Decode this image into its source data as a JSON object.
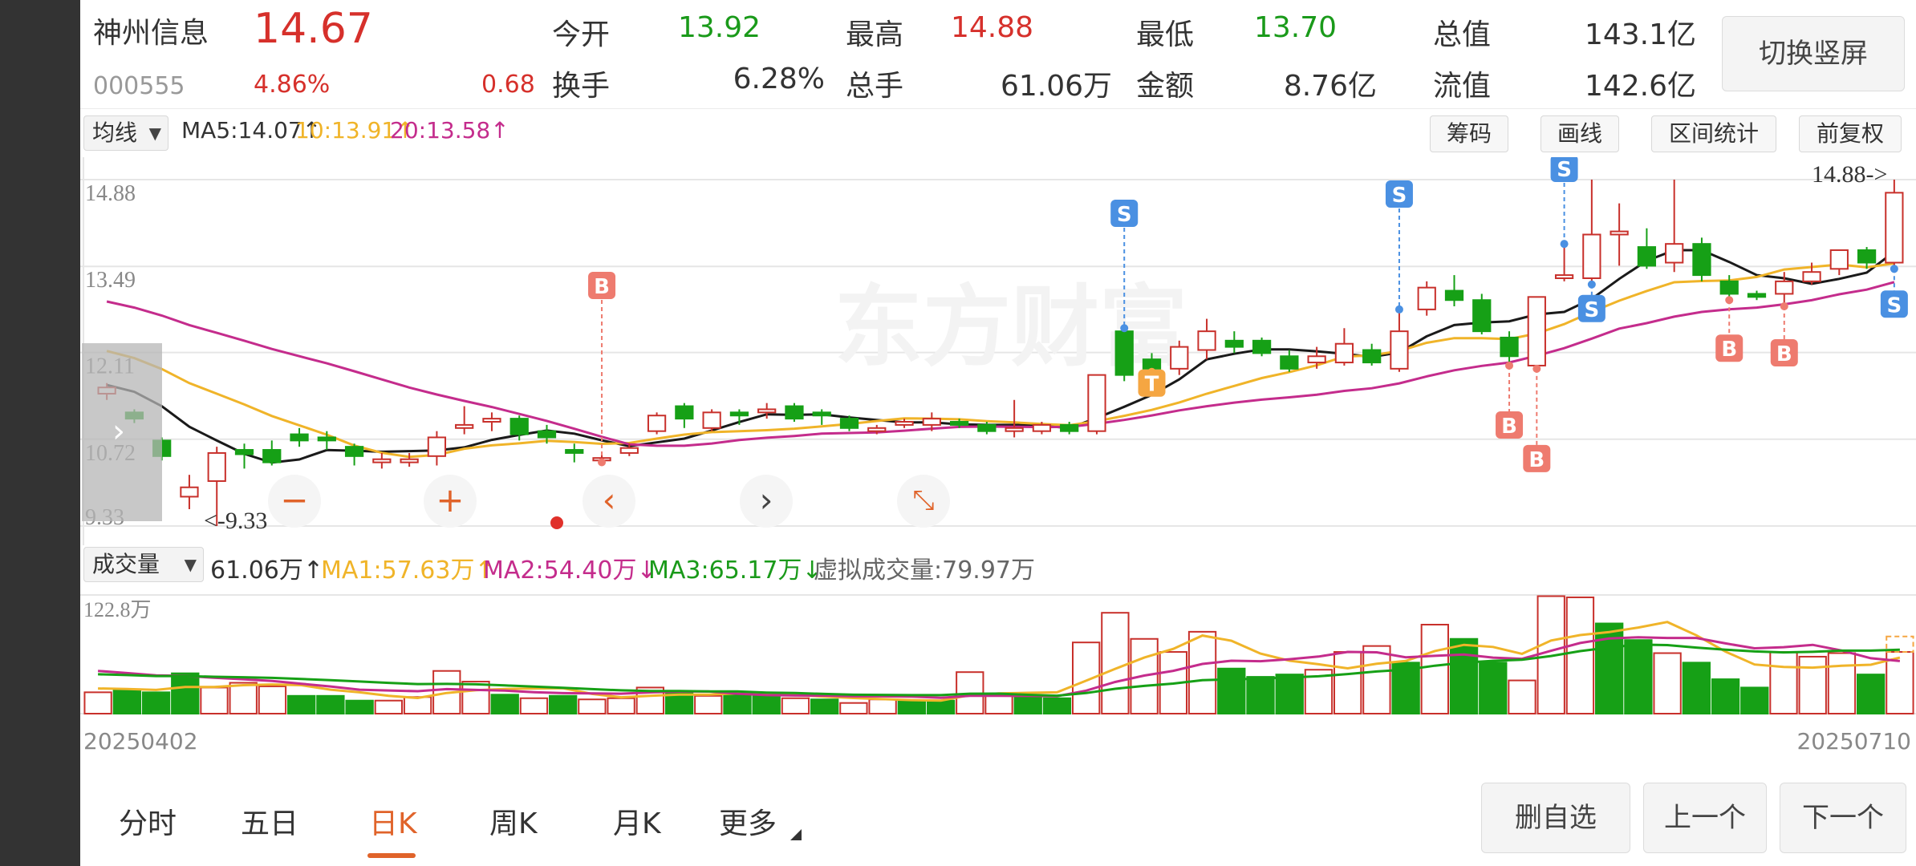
{
  "quote": {
    "name": "神州信息",
    "price": "14.67",
    "code": "000555",
    "change_pct": "4.86%",
    "change_amt": "0.68",
    "open_label": "今开",
    "open": "13.92",
    "high_label": "最高",
    "high": "14.88",
    "low_label": "最低",
    "low": "13.70",
    "mcap_label": "总值",
    "mcap": "143.1亿",
    "turnover_label": "换手",
    "turnover": "6.28%",
    "volume_label": "总手",
    "volume": "61.06万",
    "amount_label": "金额",
    "amount": "8.76亿",
    "float_label": "流值",
    "float_mcap": "142.6亿",
    "switch_button": "切换竖屏"
  },
  "toolbar": {
    "indicator": "均线",
    "ma5": "MA5:14.07↑",
    "ma10": "10:13.91↑",
    "ma20": "20:13.58↑",
    "chips": "筹码",
    "draw": "画线",
    "range_stats": "区间统计",
    "adjust": "前复权"
  },
  "price_axis": {
    "labels": [
      "14.88",
      "13.49",
      "12.11",
      "10.72",
      "9.33"
    ],
    "high_marker": "14.88->",
    "low_marker": "<-9.33"
  },
  "signals": {
    "s": "S",
    "b": "B",
    "t": "T"
  },
  "watermark": "东方财富",
  "volume": {
    "indicator": "成交量",
    "current": "61.06万↑",
    "ma1": "MA1:57.63万↑",
    "ma2": "MA2:54.40万↓",
    "ma3": "MA3:65.17万↓",
    "virtual": "虚拟成交量:79.97万",
    "max_label": "122.8万"
  },
  "dates": {
    "start": "20250402",
    "end": "20250710"
  },
  "tabs": [
    {
      "label": "分时"
    },
    {
      "label": "五日"
    },
    {
      "label": "日K"
    },
    {
      "label": "周K"
    },
    {
      "label": "月K"
    },
    {
      "label": "更多"
    }
  ],
  "bottom_buttons": {
    "remove": "删自选",
    "prev": "上一个",
    "next": "下一个"
  },
  "colors": {
    "up": "#c8302b",
    "down": "#16a016",
    "ma5": "#1a1a1a",
    "ma10": "#f0b429",
    "ma20": "#c42c8c",
    "sell_badge": "#4a90e2",
    "buy_badge": "#ee7b6f",
    "t_badge": "#f5a642"
  },
  "chart_data": {
    "type": "candlestick",
    "ylim": [
      9.33,
      14.88
    ],
    "candles": [
      [
        11.45,
        11.55,
        11.35,
        11.62
      ],
      [
        11.15,
        11.05,
        10.98,
        11.2
      ],
      [
        10.7,
        10.45,
        10.38,
        10.75
      ],
      [
        9.8,
        9.95,
        9.6,
        10.15
      ],
      [
        10.05,
        10.5,
        9.33,
        10.6
      ],
      [
        10.55,
        10.48,
        10.25,
        10.65
      ],
      [
        10.55,
        10.35,
        10.3,
        10.7
      ],
      [
        10.8,
        10.7,
        10.6,
        10.9
      ],
      [
        10.75,
        10.7,
        10.55,
        10.85
      ],
      [
        10.6,
        10.45,
        10.3,
        10.65
      ],
      [
        10.35,
        10.4,
        10.25,
        10.5
      ],
      [
        10.35,
        10.4,
        10.28,
        10.5
      ],
      [
        10.45,
        10.75,
        10.3,
        10.85
      ],
      [
        10.9,
        10.95,
        10.8,
        11.25
      ],
      [
        11.0,
        11.05,
        10.85,
        11.15
      ],
      [
        11.05,
        10.8,
        10.7,
        11.1
      ],
      [
        10.85,
        10.75,
        10.65,
        10.95
      ],
      [
        10.55,
        10.5,
        10.35,
        10.65
      ],
      [
        10.38,
        10.42,
        10.3,
        10.48
      ],
      [
        10.5,
        10.58,
        10.45,
        10.65
      ],
      [
        10.85,
        11.1,
        10.8,
        11.15
      ],
      [
        11.25,
        11.05,
        10.9,
        11.3
      ],
      [
        10.9,
        11.15,
        10.85,
        11.2
      ],
      [
        11.15,
        11.1,
        10.95,
        11.2
      ],
      [
        11.15,
        11.2,
        11.05,
        11.3
      ],
      [
        11.25,
        11.05,
        11.0,
        11.3
      ],
      [
        11.15,
        11.1,
        10.95,
        11.2
      ],
      [
        11.05,
        10.9,
        10.85,
        11.1
      ],
      [
        10.85,
        10.9,
        10.8,
        10.95
      ],
      [
        10.95,
        11.0,
        10.9,
        11.05
      ],
      [
        10.95,
        11.05,
        10.85,
        11.15
      ],
      [
        11.0,
        10.95,
        10.9,
        11.05
      ],
      [
        10.95,
        10.85,
        10.8,
        11.0
      ],
      [
        10.85,
        10.9,
        10.75,
        11.35
      ],
      [
        10.85,
        10.95,
        10.8,
        11.0
      ],
      [
        10.95,
        10.85,
        10.8,
        11.0
      ],
      [
        10.85,
        11.75,
        10.8,
        11.75
      ],
      [
        12.45,
        11.75,
        11.65,
        12.5
      ],
      [
        12.0,
        11.85,
        11.8,
        12.1
      ],
      [
        11.85,
        12.2,
        11.75,
        12.3
      ],
      [
        12.15,
        12.45,
        12.0,
        12.65
      ],
      [
        12.3,
        12.2,
        12.1,
        12.45
      ],
      [
        12.3,
        12.1,
        12.05,
        12.35
      ],
      [
        12.05,
        11.85,
        11.8,
        12.15
      ],
      [
        11.95,
        12.05,
        11.85,
        12.2
      ],
      [
        11.95,
        12.25,
        11.9,
        12.5
      ],
      [
        12.15,
        11.95,
        11.9,
        12.25
      ],
      [
        11.85,
        12.45,
        11.8,
        12.8
      ],
      [
        12.8,
        13.15,
        12.7,
        13.25
      ],
      [
        13.1,
        12.95,
        12.85,
        13.35
      ],
      [
        12.95,
        12.45,
        12.4,
        13.05
      ],
      [
        12.35,
        12.05,
        11.9,
        12.45
      ],
      [
        11.9,
        13.0,
        11.85,
        13.0
      ],
      [
        13.3,
        13.35,
        13.25,
        13.85
      ],
      [
        13.3,
        14.0,
        13.2,
        14.88
      ],
      [
        14.0,
        14.05,
        13.5,
        14.5
      ],
      [
        13.8,
        13.5,
        13.45,
        14.1
      ],
      [
        13.55,
        13.85,
        13.4,
        14.88
      ],
      [
        13.85,
        13.35,
        13.25,
        13.95
      ],
      [
        13.25,
        13.05,
        12.95,
        13.35
      ],
      [
        13.05,
        13.0,
        12.95,
        13.1
      ],
      [
        13.05,
        13.25,
        12.85,
        13.4
      ],
      [
        13.25,
        13.4,
        13.2,
        13.55
      ],
      [
        13.45,
        13.75,
        13.35,
        13.75
      ],
      [
        13.75,
        13.55,
        13.45,
        13.8
      ],
      [
        13.55,
        14.67,
        13.45,
        14.88
      ]
    ],
    "volumes": [
      [
        0.18,
        1
      ],
      [
        0.2,
        0
      ],
      [
        0.18,
        0
      ],
      [
        0.34,
        0
      ],
      [
        0.22,
        1
      ],
      [
        0.26,
        1
      ],
      [
        0.23,
        1
      ],
      [
        0.15,
        0
      ],
      [
        0.15,
        0
      ],
      [
        0.11,
        0
      ],
      [
        0.11,
        1
      ],
      [
        0.14,
        1
      ],
      [
        0.36,
        1
      ],
      [
        0.27,
        1
      ],
      [
        0.16,
        0
      ],
      [
        0.13,
        1
      ],
      [
        0.15,
        0
      ],
      [
        0.12,
        1
      ],
      [
        0.13,
        1
      ],
      [
        0.22,
        1
      ],
      [
        0.18,
        0
      ],
      [
        0.15,
        1
      ],
      [
        0.17,
        0
      ],
      [
        0.15,
        0
      ],
      [
        0.13,
        1
      ],
      [
        0.12,
        0
      ],
      [
        0.09,
        1
      ],
      [
        0.12,
        1
      ],
      [
        0.11,
        0
      ],
      [
        0.11,
        0
      ],
      [
        0.35,
        1
      ],
      [
        0.16,
        1
      ],
      [
        0.15,
        0
      ],
      [
        0.13,
        0
      ],
      [
        0.6,
        1
      ],
      [
        0.85,
        1
      ],
      [
        0.63,
        1
      ],
      [
        0.52,
        1
      ],
      [
        0.69,
        1
      ],
      [
        0.38,
        0
      ],
      [
        0.31,
        0
      ],
      [
        0.33,
        0
      ],
      [
        0.37,
        1
      ],
      [
        0.52,
        1
      ],
      [
        0.57,
        1
      ],
      [
        0.43,
        0
      ],
      [
        0.75,
        1
      ],
      [
        0.63,
        0
      ],
      [
        0.43,
        0
      ],
      [
        0.28,
        1
      ],
      [
        0.99,
        1
      ],
      [
        0.98,
        1
      ],
      [
        0.76,
        0
      ],
      [
        0.62,
        0
      ],
      [
        0.51,
        1
      ],
      [
        0.43,
        0
      ],
      [
        0.29,
        0
      ],
      [
        0.22,
        0
      ],
      [
        0.52,
        1
      ],
      [
        0.48,
        1
      ],
      [
        0.51,
        1
      ],
      [
        0.33,
        0
      ],
      [
        0.52,
        1
      ]
    ],
    "series": [
      {
        "name": "MA5",
        "color": "#1a1a1a"
      },
      {
        "name": "10",
        "color": "#f0b429"
      },
      {
        "name": "20",
        "color": "#c42c8c"
      }
    ]
  }
}
